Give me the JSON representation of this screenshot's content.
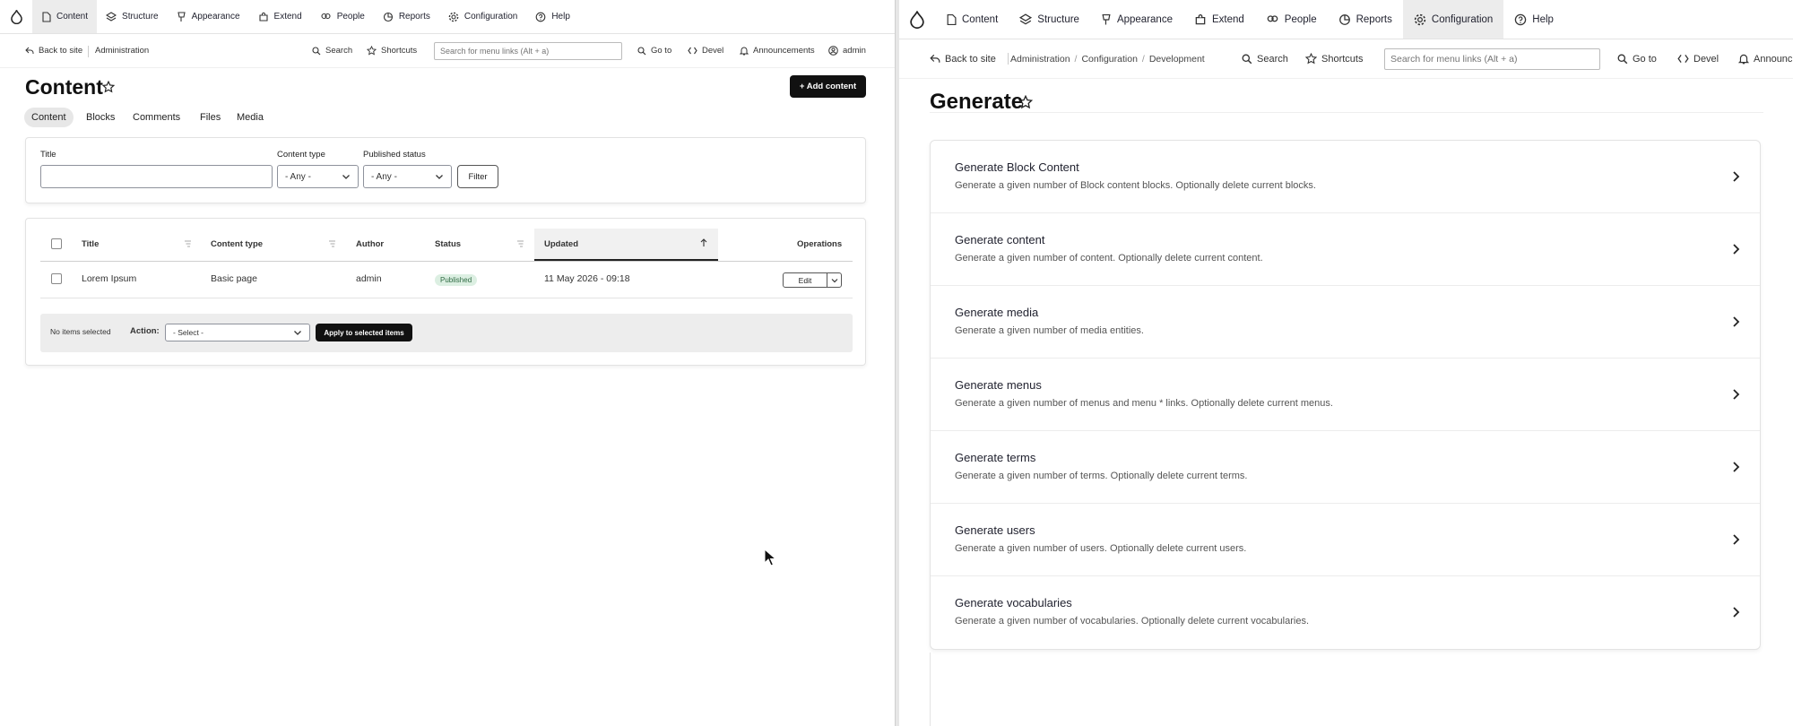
{
  "left": {
    "toolbar": {
      "items": [
        {
          "label": "Content",
          "icon": "file-icon",
          "active": true
        },
        {
          "label": "Structure",
          "icon": "layers-icon"
        },
        {
          "label": "Appearance",
          "icon": "brush-icon"
        },
        {
          "label": "Extend",
          "icon": "puzzle-icon"
        },
        {
          "label": "People",
          "icon": "people-icon"
        },
        {
          "label": "Reports",
          "icon": "chart-icon"
        },
        {
          "label": "Configuration",
          "icon": "gear-icon"
        },
        {
          "label": "Help",
          "icon": "help-icon"
        }
      ]
    },
    "secondary": {
      "back": "Back to site",
      "admin": "Administration",
      "search": "Search",
      "shortcuts": "Shortcuts",
      "search_placeholder": "Search for menu links (Alt + a)",
      "goto": "Go to",
      "devel": "Devel",
      "announcements": "Announcements",
      "user": "admin"
    },
    "page_title": "Content",
    "add_content": "+ Add content",
    "tabs": [
      "Content",
      "Blocks",
      "Comments",
      "Files",
      "Media"
    ],
    "filter": {
      "title_label": "Title",
      "content_type_label": "Content type",
      "content_type_value": "- Any -",
      "published_label": "Published status",
      "published_value": "- Any -",
      "filter_button": "Filter"
    },
    "table": {
      "headers": [
        "Title",
        "Content type",
        "Author",
        "Status",
        "Updated",
        "Operations"
      ],
      "rows": [
        {
          "title": "Lorem Ipsum",
          "type": "Basic page",
          "author": "admin",
          "status": "Published",
          "updated": "11 May 2026 - 09:18",
          "op": "Edit"
        }
      ]
    },
    "bulk": {
      "none_selected": "No items selected",
      "action_label": "Action:",
      "select_value": "- Select -",
      "apply": "Apply to selected items"
    }
  },
  "right": {
    "toolbar": {
      "items": [
        {
          "label": "Content",
          "icon": "file-icon"
        },
        {
          "label": "Structure",
          "icon": "layers-icon"
        },
        {
          "label": "Appearance",
          "icon": "brush-icon"
        },
        {
          "label": "Extend",
          "icon": "puzzle-icon"
        },
        {
          "label": "People",
          "icon": "people-icon"
        },
        {
          "label": "Reports",
          "icon": "chart-icon"
        },
        {
          "label": "Configuration",
          "icon": "gear-icon",
          "active": true
        },
        {
          "label": "Help",
          "icon": "help-icon"
        }
      ]
    },
    "secondary": {
      "back": "Back to site",
      "breadcrumb": [
        "Administration",
        "Configuration",
        "Development"
      ],
      "search": "Search",
      "shortcuts": "Shortcuts",
      "search_placeholder": "Search for menu links (Alt + a)",
      "goto": "Go to",
      "devel": "Devel",
      "announcements": "Announc"
    },
    "page_title": "Generate",
    "items": [
      {
        "title": "Generate Block Content",
        "desc": "Generate a given number of Block content blocks. Optionally delete current blocks."
      },
      {
        "title": "Generate content",
        "desc": "Generate a given number of content. Optionally delete current content."
      },
      {
        "title": "Generate media",
        "desc": "Generate a given number of media entities."
      },
      {
        "title": "Generate menus",
        "desc": "Generate a given number of menus and menu * links. Optionally delete current menus."
      },
      {
        "title": "Generate terms",
        "desc": "Generate a given number of terms. Optionally delete current terms."
      },
      {
        "title": "Generate users",
        "desc": "Generate a given number of users. Optionally delete current users."
      },
      {
        "title": "Generate vocabularies",
        "desc": "Generate a given number of vocabularies. Optionally delete current vocabularies."
      }
    ]
  },
  "colors": {
    "accent": "#111111",
    "active_bg": "#ececec",
    "published_bg": "#dcefe2",
    "published_text": "#2f6b43"
  }
}
